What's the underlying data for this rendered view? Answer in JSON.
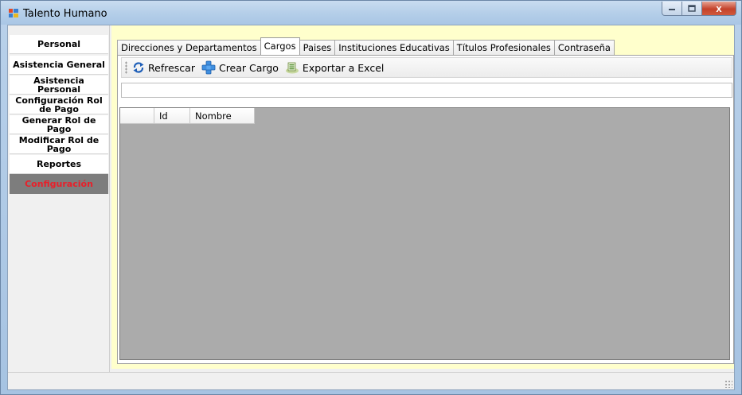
{
  "window": {
    "title": "Talento Humano",
    "close_glyph": "x",
    "colors": {
      "titlebar": "#b5cfe9",
      "close": "#c4422b",
      "content_bg": "#ffffcc"
    }
  },
  "sidebar": {
    "items": [
      {
        "label": "Personal"
      },
      {
        "label": "Asistencia General"
      },
      {
        "label": "Asistencia Personal"
      },
      {
        "label": "Configuración Rol de Pago"
      },
      {
        "label": "Generar Rol de Pago"
      },
      {
        "label": "Modificar Rol de Pago"
      },
      {
        "label": "Reportes"
      },
      {
        "label": "Configuración"
      }
    ],
    "active_index": 7,
    "active_color": "#e8202a"
  },
  "tabs": [
    {
      "label": "Direcciones y Departamentos"
    },
    {
      "label": "Cargos"
    },
    {
      "label": "Paises"
    },
    {
      "label": "Instituciones Educativas"
    },
    {
      "label": "Títulos Profesionales"
    },
    {
      "label": "Contraseña"
    }
  ],
  "selected_tab": "Cargos",
  "toolbar": {
    "refresh_label": "Refrescar",
    "refresh_icon": "refresh-icon",
    "create_label": "Crear Cargo",
    "create_icon": "plus-icon",
    "export_label": "Exportar a Excel",
    "export_icon": "excel-export-icon"
  },
  "search": {
    "value": ""
  },
  "grid": {
    "columns": [
      {
        "label": ""
      },
      {
        "label": "Id"
      },
      {
        "label": "Nombre"
      }
    ],
    "rows": []
  }
}
